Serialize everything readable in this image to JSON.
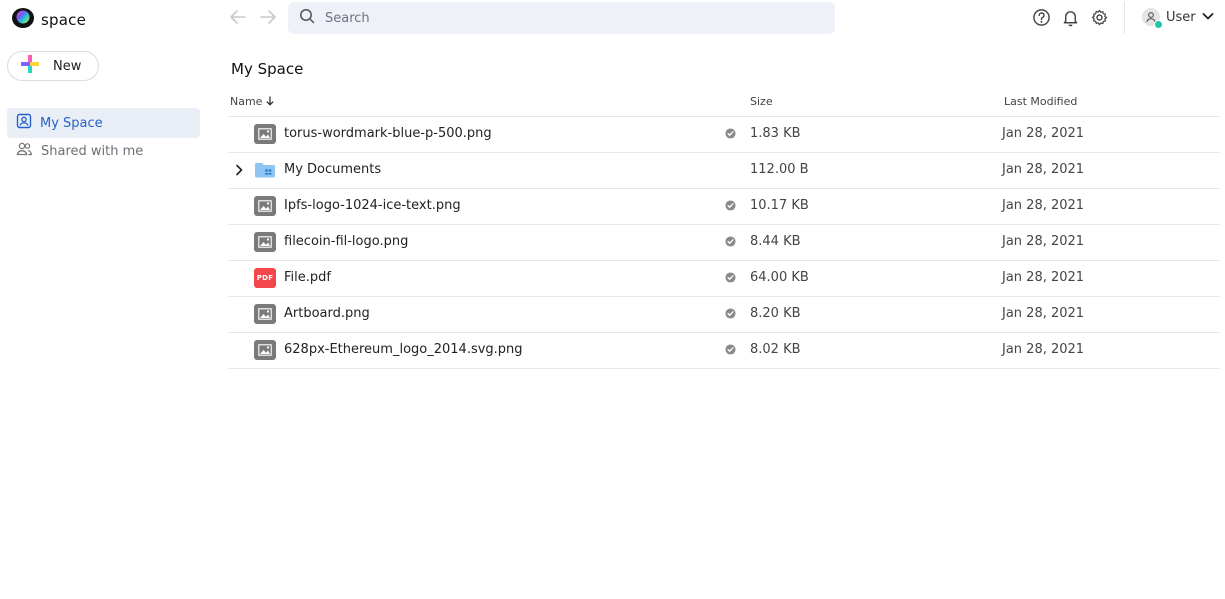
{
  "app": {
    "name": "space"
  },
  "search": {
    "placeholder": "Search"
  },
  "user": {
    "label": "User"
  },
  "sidebar": {
    "new_label": "New",
    "items": [
      {
        "label": "My Space",
        "icon": "my-space-icon",
        "active": true
      },
      {
        "label": "Shared with me",
        "icon": "users-icon",
        "active": false
      }
    ]
  },
  "main": {
    "title": "My Space",
    "columns": {
      "name": "Name",
      "size": "Size",
      "modified": "Last Modified"
    },
    "rows": [
      {
        "name": "torus-wordmark-blue-p-500.png",
        "type": "image",
        "synced": true,
        "size": "1.83 KB",
        "modified": "Jan 28, 2021"
      },
      {
        "name": "My Documents",
        "type": "folder",
        "synced": false,
        "size": "112.00 B",
        "modified": "Jan 28, 2021"
      },
      {
        "name": "Ipfs-logo-1024-ice-text.png",
        "type": "image",
        "synced": true,
        "size": "10.17 KB",
        "modified": "Jan 28, 2021"
      },
      {
        "name": "filecoin-fil-logo.png",
        "type": "image",
        "synced": true,
        "size": "8.44 KB",
        "modified": "Jan 28, 2021"
      },
      {
        "name": "File.pdf",
        "type": "pdf",
        "pdf_label": "PDF",
        "synced": true,
        "size": "64.00 KB",
        "modified": "Jan 28, 2021"
      },
      {
        "name": "Artboard.png",
        "type": "image",
        "synced": true,
        "size": "8.20 KB",
        "modified": "Jan 28, 2021"
      },
      {
        "name": "628px-Ethereum_logo_2014.svg.png",
        "type": "image",
        "synced": true,
        "size": "8.02 KB",
        "modified": "Jan 28, 2021"
      }
    ]
  },
  "colors": {
    "accent": "#2563c9",
    "search_bg": "#eef1f8",
    "active_bg": "#e9eef7",
    "status_online": "#1fc9a7",
    "pdf_red": "#f2464b"
  }
}
